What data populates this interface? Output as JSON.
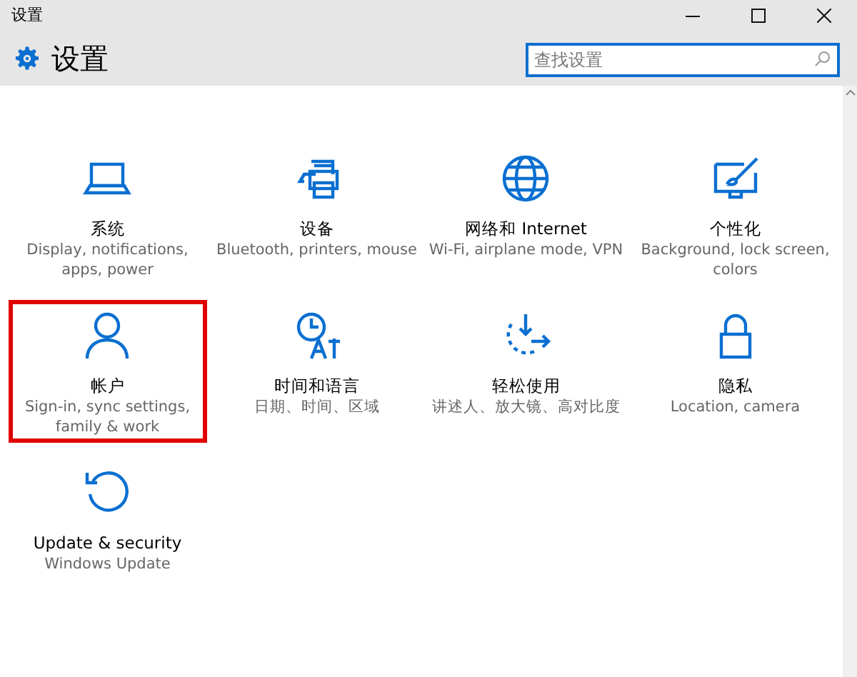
{
  "window": {
    "title": "设置"
  },
  "header": {
    "title": "设置"
  },
  "search": {
    "placeholder": "查找设置",
    "focused": true
  },
  "tiles": [
    {
      "title": "系统",
      "description": "Display, notifications, apps, power",
      "highlighted": false
    },
    {
      "title": "设备",
      "description": "Bluetooth, printers, mouse",
      "highlighted": false
    },
    {
      "title": "网络和 Internet",
      "description": "Wi-Fi, airplane mode, VPN",
      "highlighted": false
    },
    {
      "title": "个性化",
      "description": "Background, lock screen, colors",
      "highlighted": false
    },
    {
      "title": "帐户",
      "description": "Sign-in, sync settings, family & work",
      "highlighted": true
    },
    {
      "title": "时间和语言",
      "description": "日期、时间、区域",
      "highlighted": false
    },
    {
      "title": "轻松使用",
      "description": "讲述人、放大镜、高对比度",
      "highlighted": false
    },
    {
      "title": "隐私",
      "description": "Location, camera",
      "highlighted": false
    },
    {
      "title": "Update & security",
      "description": "Windows Update",
      "highlighted": false
    }
  ]
}
